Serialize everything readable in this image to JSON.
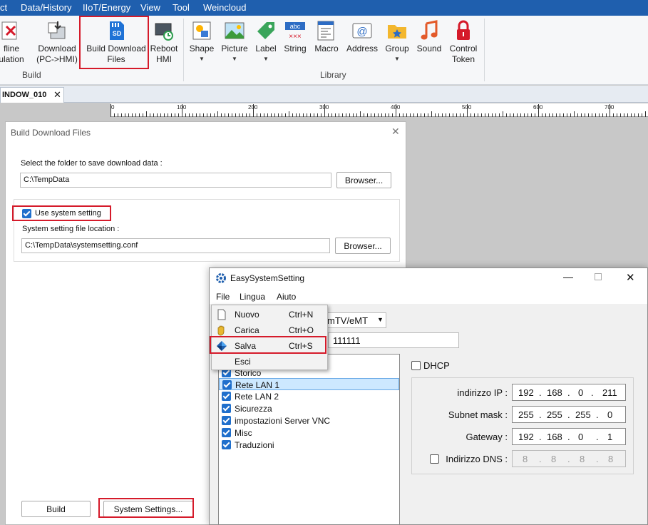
{
  "menubar": {
    "items": [
      "ct",
      "Data/History",
      "IIoT/Energy",
      "View",
      "Tool",
      "Weincloud"
    ]
  },
  "ribbon": {
    "buttons": [
      {
        "label": "fline\nulation"
      },
      {
        "label": "Download\n(PC->HMI)"
      },
      {
        "label": "Build Download\nFiles",
        "badge": "SD"
      },
      {
        "label": "Reboot\nHMI"
      },
      {
        "label": "Shape"
      },
      {
        "label": "Picture"
      },
      {
        "label": "Label"
      },
      {
        "label": "String",
        "badge": "abc"
      },
      {
        "label": "Macro"
      },
      {
        "label": "Address"
      },
      {
        "label": "Group"
      },
      {
        "label": "Sound"
      },
      {
        "label": "Control\nToken"
      }
    ],
    "groups": {
      "build": "Build",
      "library": "Library"
    }
  },
  "tab": {
    "label": "INDOW_010"
  },
  "ruler": {
    "ticks": [
      "0",
      "100",
      "200",
      "300",
      "400",
      "500",
      "600",
      "700"
    ]
  },
  "build_dialog": {
    "title": "Build Download Files",
    "folder_label": "Select the folder to save download data :",
    "folder_value": "C:\\TempData",
    "browse1": "Browser...",
    "use_system_setting": "Use system setting",
    "file_location_label": "System setting file location :",
    "file_location_value": "C:\\TempData\\systemsetting.conf",
    "browse2": "Browser...",
    "build_button": "Build",
    "system_settings_button": "System Settings..."
  },
  "easy": {
    "title": "EasySystemSetting",
    "menu": [
      "File",
      "Lingua",
      "Aiuto"
    ],
    "file_menu": [
      {
        "label": "Nuovo",
        "shortcut": "Ctrl+N"
      },
      {
        "label": "Carica",
        "shortcut": "Ctrl+O"
      },
      {
        "label": "Salva",
        "shortcut": "Ctrl+S"
      },
      {
        "label": "Esci",
        "shortcut": ""
      }
    ],
    "model_partial": "mTV/eMT",
    "password_partial": "111111",
    "tree": [
      "Storico",
      "Rete LAN 1",
      "Rete LAN 2",
      "Sicurezza",
      "impostazioni Server VNC",
      "Misc",
      "Traduzioni"
    ],
    "dhcp": "DHCP",
    "ip_label": "indirizzo IP :",
    "ip": [
      "192",
      "168",
      "0",
      "211"
    ],
    "subnet_label": "Subnet mask :",
    "subnet": [
      "255",
      "255",
      "255",
      "0"
    ],
    "gateway_label": "Gateway :",
    "gateway": [
      "192",
      "168",
      "0",
      "1"
    ],
    "dns_label": "Indirizzo DNS :",
    "dns": [
      "8",
      "8",
      "8",
      "8"
    ],
    "ip_sep": "."
  },
  "colors": {
    "menubar": "#1f5fae",
    "highlight": "#d51a2a",
    "checkbox": "#1f6fcc",
    "selection": "#cde8ff"
  }
}
